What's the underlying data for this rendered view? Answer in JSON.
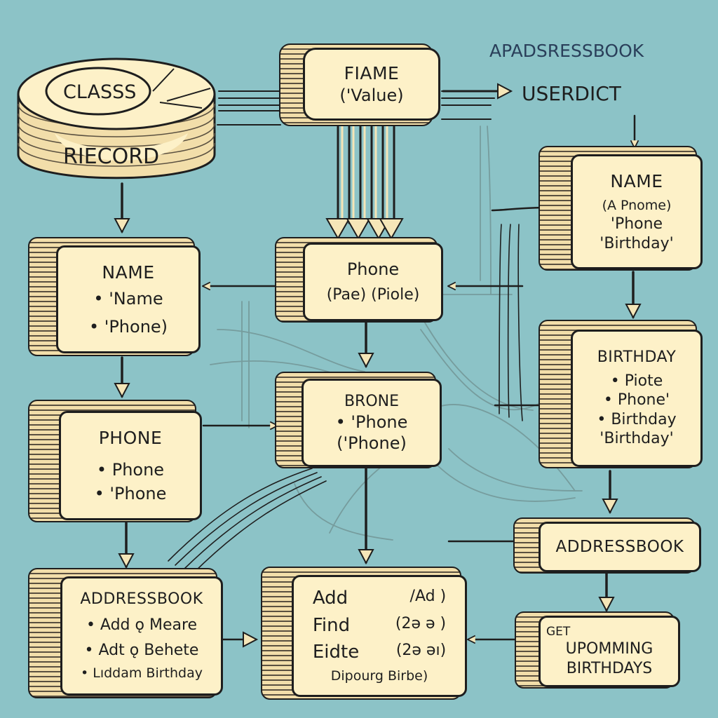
{
  "header": {
    "label": "APADSRESSBOOK",
    "userdict": "USERDICT"
  },
  "record": {
    "inner": "CLASSS",
    "outer": "RIECORD"
  },
  "fiame": {
    "title": "FIAME",
    "sub": "('Value)"
  },
  "name_left": {
    "title": "NAME",
    "items": [
      "'Name",
      "'Phone)"
    ]
  },
  "phone_left": {
    "title": "PHONE",
    "items": [
      "Phone",
      "'Phone"
    ]
  },
  "addressbook_left": {
    "title": "ADDRESSBOOK",
    "items": [
      "Add ǫ Meare",
      "Adt ǫ Behete",
      "Lıddam Birthday"
    ]
  },
  "phone_mid": {
    "title": "Phone",
    "sub": "(Pae) (Piole)"
  },
  "brone_mid": {
    "title": "BRONE",
    "bullet": "'Phone",
    "sub": "('Phone)"
  },
  "ops": {
    "rows": [
      {
        "left": "Add",
        "right": "/Ad )"
      },
      {
        "left": "Find",
        "right": "(2ə ə )"
      },
      {
        "left": "Eidte",
        "right": "(2ə əı)"
      }
    ],
    "tail": "Dipourg Birbe)"
  },
  "name_right": {
    "title": "NAME",
    "l1": "(A Pnome)",
    "l2": "'Phone",
    "l3": "'Birthday'"
  },
  "birthday_right": {
    "title": "BIRTHDAY",
    "items": [
      "Piote",
      "Phone'",
      "Birthday"
    ],
    "last": "'Birthday'"
  },
  "addressbook_right": {
    "title": "ADDRESSBOOK"
  },
  "upcoming": {
    "l1": "GET",
    "l2": "UPOMMING",
    "l3": "BIRTHDAYS"
  },
  "colors": {
    "background": "#8cc3c7",
    "box_fill": "#fdf1c8",
    "outline": "#1e1e1e"
  }
}
